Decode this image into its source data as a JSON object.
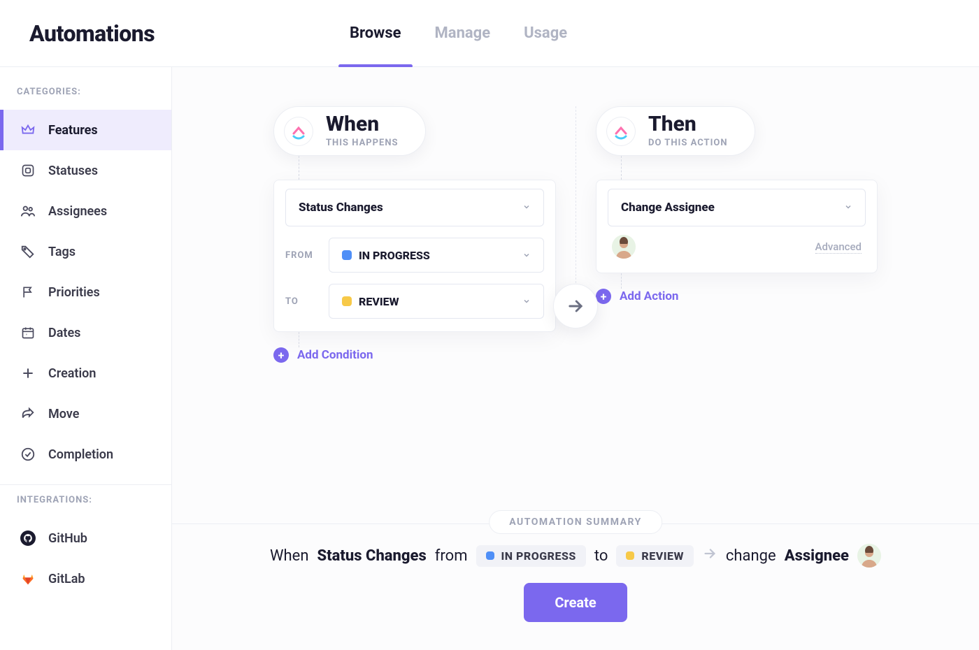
{
  "header": {
    "title": "Automations",
    "tabs": [
      {
        "label": "Browse",
        "active": true
      },
      {
        "label": "Manage",
        "active": false
      },
      {
        "label": "Usage",
        "active": false
      }
    ]
  },
  "sidebar": {
    "categories_title": "CATEGORIES:",
    "integrations_title": "INTEGRATIONS:",
    "categories": [
      {
        "name": "features",
        "label": "Features",
        "icon": "crown-icon",
        "active": true
      },
      {
        "name": "statuses",
        "label": "Statuses",
        "icon": "square-icon",
        "active": false
      },
      {
        "name": "assignees",
        "label": "Assignees",
        "icon": "people-icon",
        "active": false
      },
      {
        "name": "tags",
        "label": "Tags",
        "icon": "tag-icon",
        "active": false
      },
      {
        "name": "priorities",
        "label": "Priorities",
        "icon": "flag-icon",
        "active": false
      },
      {
        "name": "dates",
        "label": "Dates",
        "icon": "calendar-icon",
        "active": false
      },
      {
        "name": "creation",
        "label": "Creation",
        "icon": "plus-icon",
        "active": false
      },
      {
        "name": "move",
        "label": "Move",
        "icon": "share-icon",
        "active": false
      },
      {
        "name": "completion",
        "label": "Completion",
        "icon": "check-icon",
        "active": false
      }
    ],
    "integrations": [
      {
        "name": "github",
        "label": "GitHub",
        "icon": "github-icon"
      },
      {
        "name": "gitlab",
        "label": "GitLab",
        "icon": "gitlab-icon"
      }
    ]
  },
  "builder": {
    "when": {
      "title": "When",
      "subtitle": "THIS HAPPENS",
      "trigger_label": "Status Changes",
      "from_label": "FROM",
      "from_status": "IN PROGRESS",
      "from_color": "#4f8ff7",
      "to_label": "TO",
      "to_status": "REVIEW",
      "to_color": "#f7c948",
      "add_condition_label": "Add Condition"
    },
    "then": {
      "title": "Then",
      "subtitle": "DO THIS ACTION",
      "action_label": "Change Assignee",
      "advanced_label": "Advanced",
      "add_action_label": "Add Action"
    }
  },
  "summary": {
    "badge": "AUTOMATION SUMMARY",
    "txt_when": "When",
    "txt_trigger": "Status Changes",
    "txt_from": "from",
    "txt_in_progress": "IN PROGRESS",
    "txt_to": "to",
    "txt_review": "REVIEW",
    "txt_change": "change",
    "txt_assignee": "Assignee",
    "create_label": "Create"
  },
  "colors": {
    "accent": "#7b68ee",
    "in_progress": "#4f8ff7",
    "review": "#f7c948"
  }
}
